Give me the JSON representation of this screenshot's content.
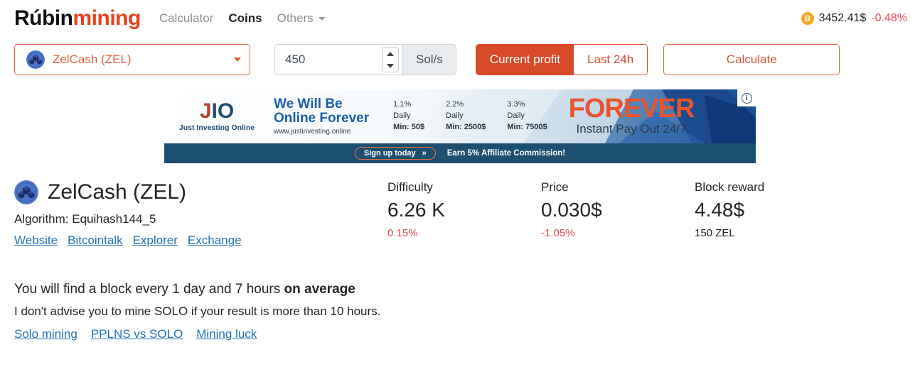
{
  "header": {
    "brand_first": "Rúbin",
    "brand_second": "mining",
    "nav": [
      {
        "label": "Calculator",
        "active": false,
        "caret": false
      },
      {
        "label": "Coins",
        "active": true,
        "caret": false
      },
      {
        "label": "Others",
        "active": false,
        "caret": true
      }
    ],
    "btc_icon": "bitcoin-icon",
    "btc_glyph": "B",
    "btc_price": "3452.41$",
    "btc_change": "-0.48%"
  },
  "controls": {
    "coin_select_value": "ZelCash (ZEL)",
    "coin_select_icon": "zelcash-coin-icon",
    "hashrate_value": "450",
    "hashrate_placeholder": "450",
    "unit_label": "Sol/s",
    "toggle": [
      {
        "label": "Current profit",
        "active": true
      },
      {
        "label": "Last 24h",
        "active": false
      }
    ],
    "calculate_label": "Calculate"
  },
  "ad": {
    "logo_j": "J",
    "logo_io": "IO",
    "logo_tagline": "Just Investing Online",
    "headline_line1": "We Will Be",
    "headline_line2": "Online Forever",
    "url": "www.justinvesting.online",
    "plans": [
      {
        "rate": "1.1%",
        "period": "Daily",
        "min": "Min: 50$"
      },
      {
        "rate": "2.2%",
        "period": "Daily",
        "min": "Min: 2500$"
      },
      {
        "rate": "3.3%",
        "period": "Daily",
        "min": "Min: 7500$"
      }
    ],
    "forever_word": "FOREVER",
    "forever_sub": "Instant Pay Out 24/7",
    "signup_label": "Sign up today",
    "signup_chevrons": "»",
    "affiliate_text": "Earn 5% Affiliate Commission!",
    "info_glyph": "i"
  },
  "coin": {
    "icon": "zelcash-coin-icon",
    "name": "ZelCash (ZEL)",
    "algorithm": "Algorithm: Equihash144_5",
    "links": [
      {
        "label": "Website"
      },
      {
        "label": "Bitcointalk"
      },
      {
        "label": "Explorer"
      },
      {
        "label": "Exchange"
      }
    ]
  },
  "stats": [
    {
      "label": "Difficulty",
      "value": "6.26 K",
      "delta": "0.15%",
      "delta_sign": "pos",
      "sub": ""
    },
    {
      "label": "Price",
      "value": "0.030$",
      "delta": "-1.05%",
      "delta_sign": "neg",
      "sub": ""
    },
    {
      "label": "Block reward",
      "value": "4.48$",
      "delta": "",
      "delta_sign": "",
      "sub": "150 ZEL"
    }
  ],
  "footer": {
    "line1_plain": "You will find a block every 1 day and 7 hours ",
    "line1_bold": "on average",
    "line2": "I don't advise you to mine SOLO if your result is more than 10 hours.",
    "links": [
      {
        "label": "Solo mining"
      },
      {
        "label": "PPLNS vs SOLO"
      },
      {
        "label": "Mining luck"
      }
    ]
  },
  "colors": {
    "brand_red": "#e8401f",
    "accent": "#d64a2a",
    "link_blue": "#1f72b8",
    "negative": "#e8485a",
    "bitcoin_orange": "#f5a623"
  }
}
